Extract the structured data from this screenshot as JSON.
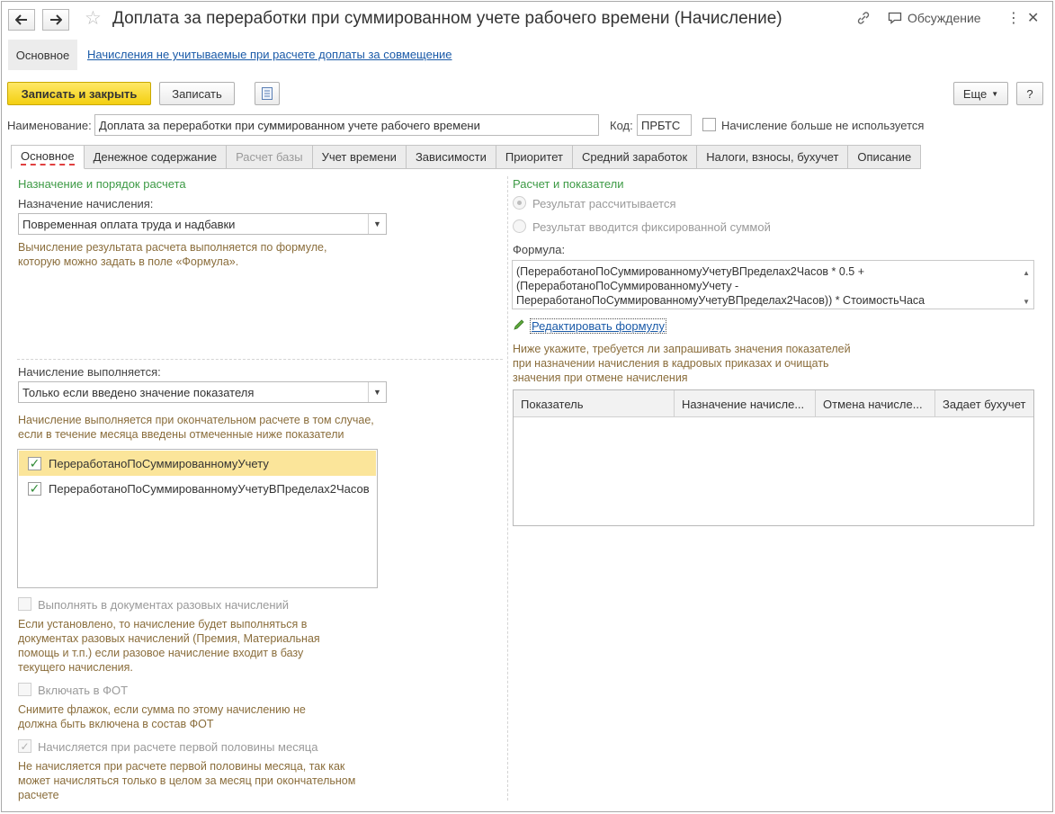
{
  "window": {
    "title": "Доплата за переработки при суммированном учете рабочего времени (Начисление)",
    "nav_back_icon": "arrow-left",
    "nav_forward_icon": "arrow-right",
    "discussion_label": "Обсуждение"
  },
  "subnav": {
    "main_label": "Основное",
    "link_label": "Начисления не учитываемые при расчете доплаты за совмещение"
  },
  "toolbar": {
    "save_close_label": "Записать и закрыть",
    "save_label": "Записать",
    "more_label": "Еще",
    "help_label": "?"
  },
  "header_fields": {
    "name_label": "Наименование:",
    "name_value": "Доплата за переработки при суммированном учете рабочего времени",
    "code_label": "Код:",
    "code_value": "ПРБТС",
    "not_used_label": "Начисление больше не используется",
    "not_used_checked": false
  },
  "tabs": [
    {
      "label": "Основное",
      "active": true,
      "disabled": false
    },
    {
      "label": "Денежное содержание",
      "active": false,
      "disabled": false
    },
    {
      "label": "Расчет базы",
      "active": false,
      "disabled": true
    },
    {
      "label": "Учет времени",
      "active": false,
      "disabled": false
    },
    {
      "label": "Зависимости",
      "active": false,
      "disabled": false
    },
    {
      "label": "Приоритет",
      "active": false,
      "disabled": false
    },
    {
      "label": "Средний заработок",
      "active": false,
      "disabled": false
    },
    {
      "label": "Налоги, взносы, бухучет",
      "active": false,
      "disabled": false
    },
    {
      "label": "Описание",
      "active": false,
      "disabled": false
    }
  ],
  "left": {
    "section_title": "Назначение и порядок расчета",
    "purpose_label": "Назначение начисления:",
    "purpose_value": "Повременная оплата труда и надбавки",
    "purpose_note_1": "Вычисление результата расчета выполняется по формуле,",
    "purpose_note_2": "которую можно задать в поле «Формула».",
    "executed_label": "Начисление выполняется:",
    "executed_value": "Только если введено значение показателя",
    "executed_note_1": "Начисление выполняется при окончательном расчете в том случае,",
    "executed_note_2": "если в течение месяца введены отмеченные ниже показатели",
    "indicators": [
      {
        "label": "ПереработаноПоСуммированномуУчету",
        "checked": true,
        "selected": true
      },
      {
        "label": "ПереработаноПоСуммированномуУчетуВПределах2Часов",
        "checked": true,
        "selected": false
      }
    ],
    "one_time_label": "Выполнять в документах разовых начислений",
    "one_time_note_1": "Если установлено, то начисление будет выполняться в",
    "one_time_note_2": "документах разовых начислений (Премия, Материальная",
    "one_time_note_3": "помощь и т.п.) если разовое начисление входит в базу",
    "one_time_note_4": "текущего начисления.",
    "fot_label": "Включать в ФОТ",
    "fot_note_1": "Снимите флажок, если сумма по этому начислению не",
    "fot_note_2": "должна быть включена в состав ФОТ",
    "half_month_label": "Начисляется при расчете первой половины месяца",
    "half_month_checked": true,
    "half_month_note_1": "Не начисляется при расчете первой половины месяца, так как",
    "half_month_note_2": "может начисляться только в целом за месяц при окончательном",
    "half_month_note_3": "расчете"
  },
  "right": {
    "section_title": "Расчет и показатели",
    "radio_calculated": "Результат рассчитывается",
    "radio_fixed": "Результат вводится фиксированной суммой",
    "formula_label": "Формула:",
    "formula_line_1": "(ПереработаноПоСуммированномуУчетуВПределах2Часов * 0.5 +",
    "formula_line_2": "(ПереработаноПоСуммированномуУчету -",
    "formula_line_3": "ПереработаноПоСуммированномуУчетуВПределах2Часов)) * СтоимостьЧаса",
    "edit_formula_label": "Редактировать формулу",
    "request_note_1": "Ниже укажите, требуется ли запрашивать значения показателей",
    "request_note_2": "при назначении начисления в кадровых приказах и очищать",
    "request_note_3": "значения при отмене начисления",
    "grid_columns": [
      "Показатель",
      "Назначение начисле...",
      "Отмена начисле...",
      "Задает бухучет"
    ]
  },
  "colors": {
    "accent_yellow": "#f3cf10",
    "section_green": "#3d9a45",
    "link_blue": "#1a5aa8",
    "note_brown": "#8a6d3b",
    "selected_row": "#fbe59a"
  }
}
